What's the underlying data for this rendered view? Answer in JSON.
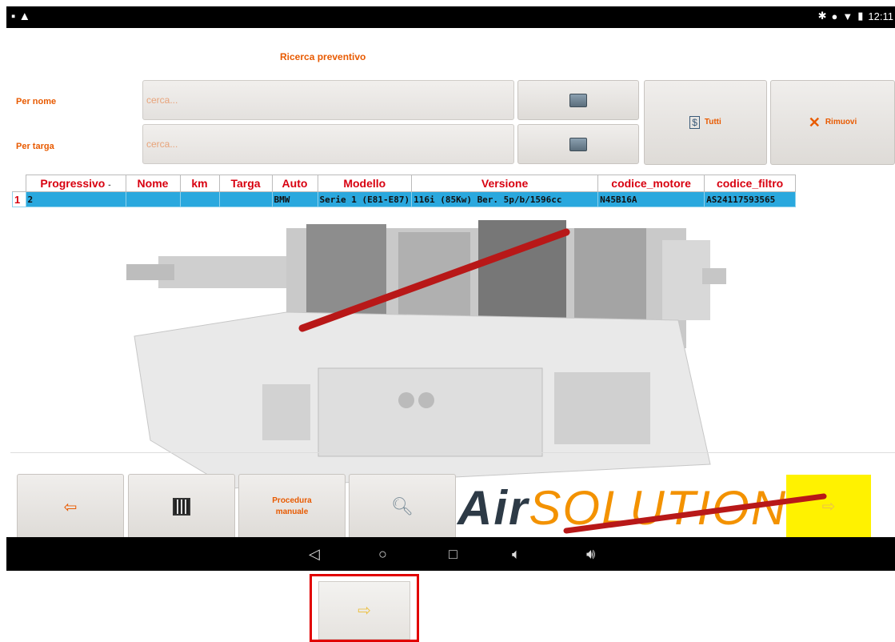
{
  "status_bar": {
    "time": "12:11",
    "left_icons": [
      "image-icon",
      "upload-icon"
    ],
    "right_icons": [
      "bluetooth-icon",
      "dnd-icon",
      "wifi-icon",
      "battery-icon"
    ]
  },
  "app": {
    "title": "Ricerca preventivo",
    "search": {
      "by_name_label": "Per nome",
      "by_name_placeholder": "cerca...",
      "by_plate_label": "Per targa",
      "by_plate_placeholder": "cerca...",
      "all_label": "Tutti",
      "remove_label": "Rimuovi"
    },
    "table": {
      "columns": [
        "Progressivo",
        "Nome",
        "km",
        "Targa",
        "Auto",
        "Modello",
        "Versione",
        "codice_motore",
        "codice_filtro"
      ],
      "sort_indicator": "-",
      "rows": [
        {
          "index": "1",
          "cells": [
            "2",
            "",
            "",
            "",
            "BMW",
            "Serie 1 (E81-E87)",
            "116i (85Kw) Ber. 5p/b/1596cc",
            "N45B16A",
            "AS24117593565"
          ]
        }
      ]
    },
    "toolbar": {
      "back_icon": "left-arrow-icon",
      "qr_icon": "qr-code-icon",
      "manual_label_line1": "Procedura",
      "manual_label_line2": "manuale",
      "search_icon": "magnifier-icon",
      "next_icon": "right-arrow-icon"
    },
    "logo": {
      "part1": "Air",
      "part2": "SOLUTIONS"
    }
  },
  "nav_bar": {
    "icons": [
      "back-triangle-icon",
      "home-circle-icon",
      "recents-square-icon",
      "volume-down-icon",
      "volume-up-icon"
    ]
  },
  "highlight": {
    "color": "#e10000",
    "target": "next-button"
  },
  "colors": {
    "accent": "#e85a00",
    "header_red": "#d80010",
    "row_blue": "#2aa8de",
    "yellow": "#fff200"
  }
}
